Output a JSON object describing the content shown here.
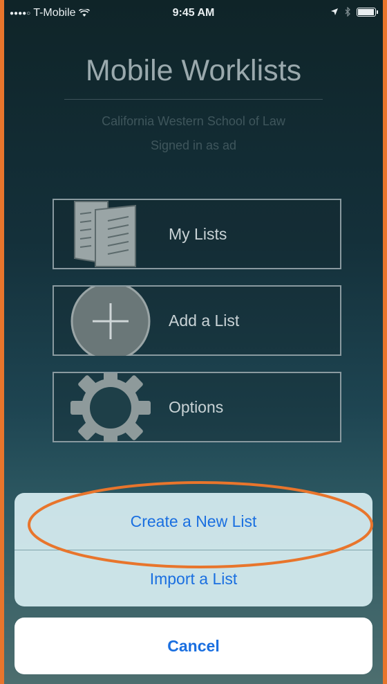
{
  "status_bar": {
    "signal": "●●●●○",
    "carrier": "T-Mobile",
    "wifi_icon": "wifi-icon",
    "time": "9:45 AM",
    "location_icon": "location-arrow-icon",
    "bluetooth_icon": "bluetooth-icon",
    "battery_icon": "battery-icon"
  },
  "header": {
    "title": "Mobile Worklists",
    "school": "California Western School of Law",
    "signed_in": "Signed in as ad"
  },
  "menu": [
    {
      "label": "My Lists",
      "icon": "documents-icon"
    },
    {
      "label": "Add a List",
      "icon": "plus-circle-icon"
    },
    {
      "label": "Options",
      "icon": "gear-icon"
    }
  ],
  "action_sheet": {
    "create": "Create a New List",
    "import": "Import a List",
    "cancel": "Cancel"
  },
  "colors": {
    "accent": "#1a6fe0",
    "highlight": "#e8752c"
  }
}
